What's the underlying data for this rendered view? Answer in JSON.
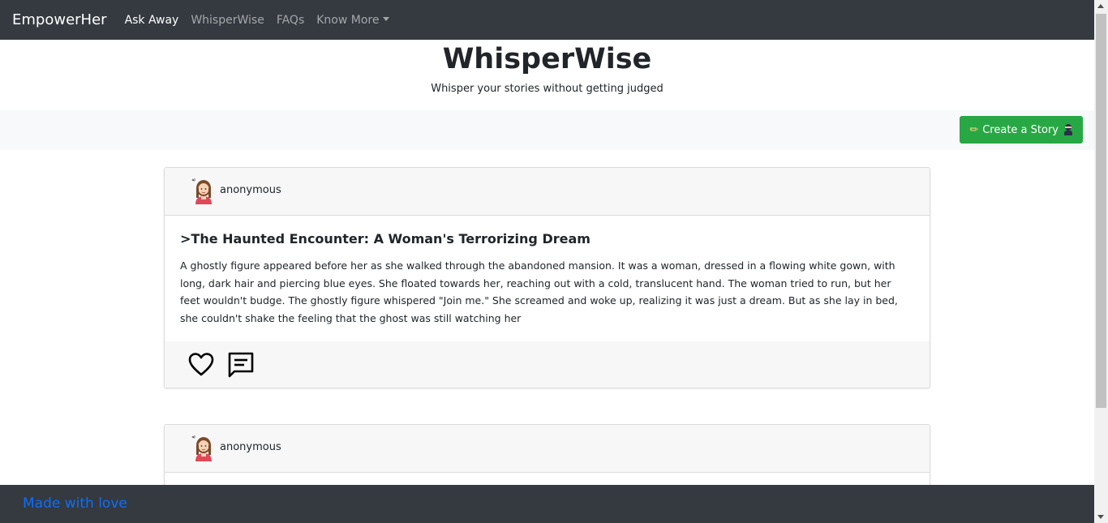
{
  "navbar": {
    "brand": "EmpowerHer",
    "links": [
      {
        "label": "Ask Away",
        "active": true
      },
      {
        "label": "WhisperWise",
        "active": false
      },
      {
        "label": "FAQs",
        "active": false
      },
      {
        "label": "Know More",
        "active": false,
        "dropdown": true
      }
    ]
  },
  "hero": {
    "title": "WhisperWise",
    "subtitle": "Whisper your stories without getting judged"
  },
  "toolbar": {
    "create_label": "Create a Story",
    "create_icon_left": "pencil-icon",
    "create_icon_right": "ninja-icon",
    "button_color": "#28a745"
  },
  "stories": [
    {
      "author": "anonymous",
      "title": ">The Haunted Encounter: A Woman's Terrorizing Dream",
      "body": "A ghostly figure appeared before her as she walked through the abandoned mansion. It was a woman, dressed in a flowing white gown, with long, dark hair and piercing blue eyes. She floated towards her, reaching out with a cold, translucent hand. The woman tried to run, but her feet wouldn't budge. The ghostly figure whispered \"Join me.\" She screamed and woke up, realizing it was just a dream. But as she lay in bed, she couldn't shake the feeling that the ghost was still watching her",
      "actions": [
        "heart-icon",
        "comment-icon"
      ]
    },
    {
      "author": "anonymous"
    }
  ],
  "footer": {
    "text": "Made with love",
    "color": "#0d6efd"
  }
}
